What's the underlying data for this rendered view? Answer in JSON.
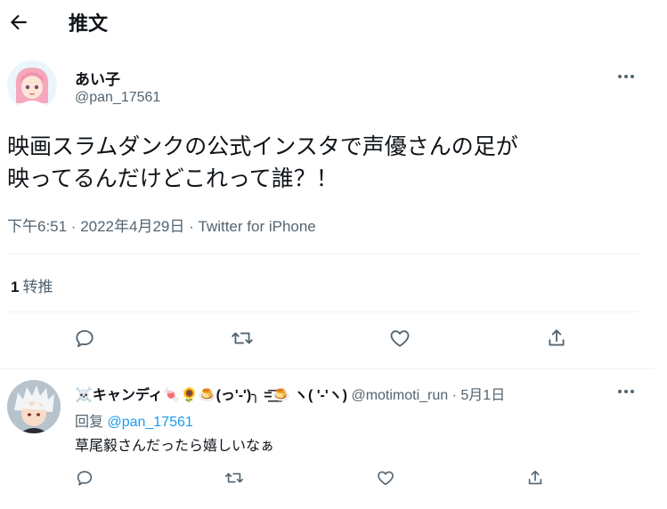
{
  "header": {
    "title": "推文"
  },
  "tweet": {
    "author_name": "あい子",
    "author_handle": "@pan_17561",
    "text": "映画スラムダンクの公式インスタで声優さんの足が\n映ってるんだけどこれって誰？！",
    "meta": "下午6:51 · 2022年4月29日 · Twitter for iPhone",
    "retweet_count": "1",
    "retweet_label": "转推"
  },
  "reply": {
    "author_name": "☠️キャンディ🍬🌻🍮(っ'-')╮ =͟͟͞͞🍮 ヽ( '-'ヽ)",
    "author_handle": "@motimoti_run",
    "separator": " · ",
    "date": "5月1日",
    "reply_to_label": "回复",
    "reply_to_handle": "@pan_17561",
    "text": "草尾毅さんだったら嬉しいなぁ"
  },
  "icons": {
    "back": "arrow-left-icon",
    "more": "more-horizontal-icon",
    "reply": "reply-bubble-icon",
    "retweet": "retweet-icon",
    "like": "heart-icon",
    "share": "share-upload-icon"
  },
  "colors": {
    "link": "#1d9bf0",
    "secondary_text": "#536471",
    "divider": "#eff3f4"
  }
}
